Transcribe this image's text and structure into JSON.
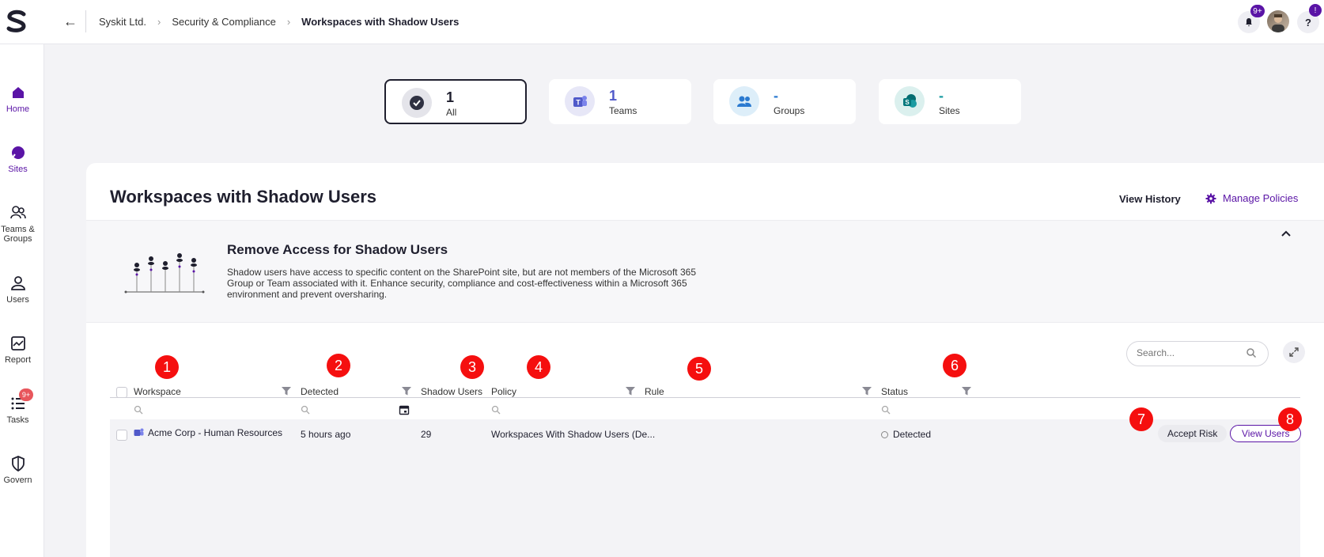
{
  "breadcrumb": [
    "Syskit Ltd.",
    "Security & Compliance",
    "Workspaces with Shadow Users"
  ],
  "topbar": {
    "notifications_badge": "9+",
    "help_label": "?",
    "help_badge": "!"
  },
  "sidebar": {
    "items": [
      {
        "label": "Home",
        "icon": "home-icon"
      },
      {
        "label": "Sites",
        "icon": "sites-icon"
      },
      {
        "label": "Teams & Groups",
        "icon": "teams-groups-icon"
      },
      {
        "label": "Users",
        "icon": "user-icon"
      },
      {
        "label": "Report",
        "icon": "report-icon"
      },
      {
        "label": "Tasks",
        "icon": "tasks-icon",
        "badge": "9+"
      },
      {
        "label": "Govern",
        "icon": "shield-icon"
      }
    ]
  },
  "filters": [
    {
      "value": "1",
      "label": "All"
    },
    {
      "value": "1",
      "label": "Teams"
    },
    {
      "value": "-",
      "label": "Groups"
    },
    {
      "value": "-",
      "label": "Sites"
    }
  ],
  "page": {
    "title": "Workspaces with Shadow Users",
    "view_history": "View History",
    "manage_policies": "Manage Policies"
  },
  "banner": {
    "title": "Remove Access for Shadow Users",
    "description": "Shadow users have access to specific content on the SharePoint site, but are not members of the Microsoft 365 Group or Team associated with it. Enhance security, compliance and cost-effectiveness within a Microsoft 365 environment and prevent oversharing."
  },
  "search": {
    "placeholder": "Search..."
  },
  "table": {
    "columns": [
      "Workspace",
      "Detected",
      "Shadow Users",
      "Policy",
      "Rule",
      "Status"
    ],
    "rows": [
      {
        "workspace": "Acme Corp - Human Resources",
        "detected": "5 hours ago",
        "shadow_users": "29",
        "policy": "Workspaces With Shadow Users (De...",
        "rule": "",
        "status": "Detected"
      }
    ],
    "actions": {
      "accept_risk": "Accept Risk",
      "view_users": "View Users"
    }
  },
  "markers": [
    "1",
    "2",
    "3",
    "4",
    "5",
    "6",
    "7",
    "8"
  ],
  "colors": {
    "accent": "#5a14a6",
    "marker": "#f50f0f"
  }
}
